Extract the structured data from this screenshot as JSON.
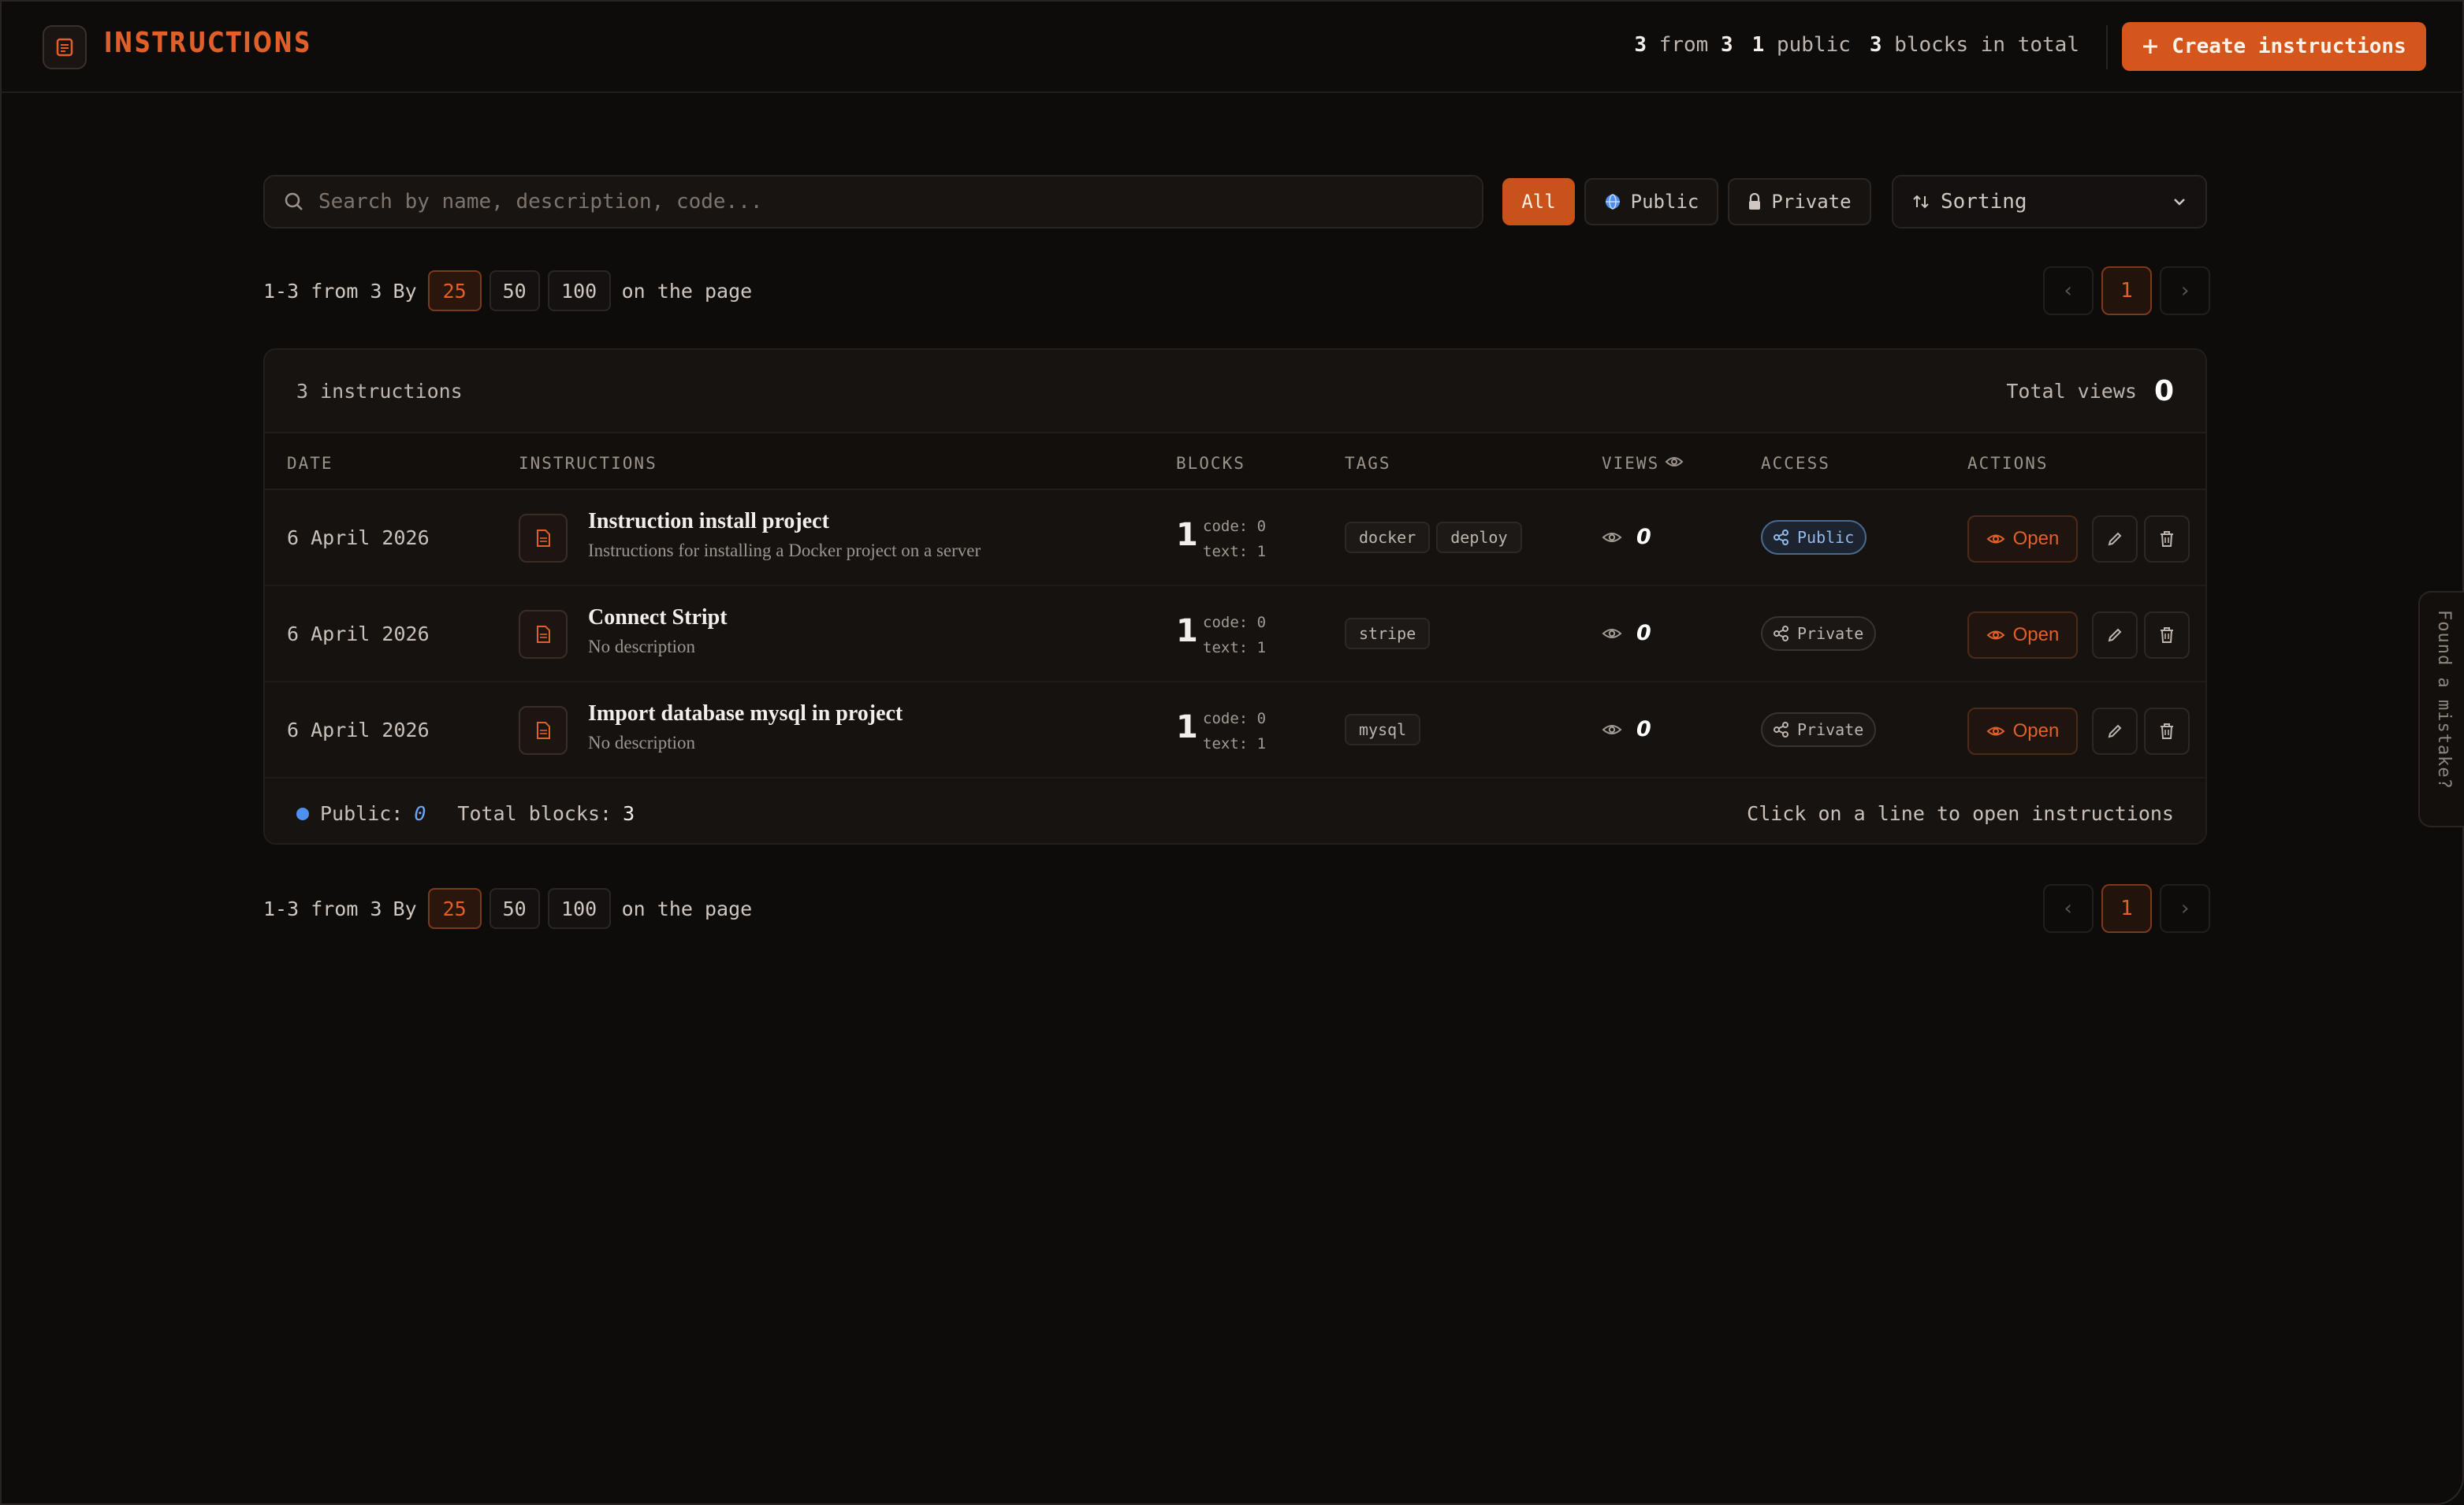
{
  "header": {
    "title": "INSTRUCTIONS",
    "stats": {
      "shown": "3",
      "from_label": "from",
      "total": "3",
      "public_count": "1",
      "public_label": "public",
      "blocks_count": "3",
      "blocks_label": "blocks in total"
    },
    "create_label": "Create instructions"
  },
  "filters": {
    "search_placeholder": "Search by name, description, code...",
    "all_label": "All",
    "public_label": "Public",
    "private_label": "Private",
    "sort_label": "Sorting",
    "active": "All"
  },
  "pagination": {
    "range": "1-3 from 3",
    "by_label": "By",
    "sizes": [
      "25",
      "50",
      "100"
    ],
    "selected_size": "25",
    "suffix": "on the page",
    "current_page": "1"
  },
  "table": {
    "count_label": "3 instructions",
    "total_views_label": "Total views",
    "total_views": "0",
    "columns": [
      "DATE",
      "INSTRUCTIONS",
      "BLOCKS",
      "TAGS",
      "VIEWS",
      "ACCESS",
      "ACTIONS"
    ],
    "rows": [
      {
        "date": "6 April 2026",
        "title": "Instruction install project",
        "description": "Instructions for installing a Docker project on a server",
        "blocks": "1",
        "code": "code: 0",
        "text": "text: 1",
        "tags": [
          "docker",
          "deploy"
        ],
        "views": "0",
        "access": "Public",
        "open_label": "Open"
      },
      {
        "date": "6 April 2026",
        "title": "Connect Stript",
        "description": "No description",
        "blocks": "1",
        "code": "code: 0",
        "text": "text: 1",
        "tags": [
          "stripe"
        ],
        "views": "0",
        "access": "Private",
        "open_label": "Open"
      },
      {
        "date": "6 April 2026",
        "title": "Import database mysql in project",
        "description": "No description",
        "blocks": "1",
        "code": "code: 0",
        "text": "text: 1",
        "tags": [
          "mysql"
        ],
        "views": "0",
        "access": "Private",
        "open_label": "Open"
      }
    ],
    "footer": {
      "public_label": "Public:",
      "public_value": "0",
      "total_blocks_label": "Total blocks:",
      "total_blocks_value": "3",
      "hint": "Click on a line to open instructions"
    }
  },
  "side_tab": "Found a mistake?",
  "colors": {
    "accent": "#d4561c",
    "background": "#0e0c0b",
    "public_blue": "#4e8ff0"
  }
}
